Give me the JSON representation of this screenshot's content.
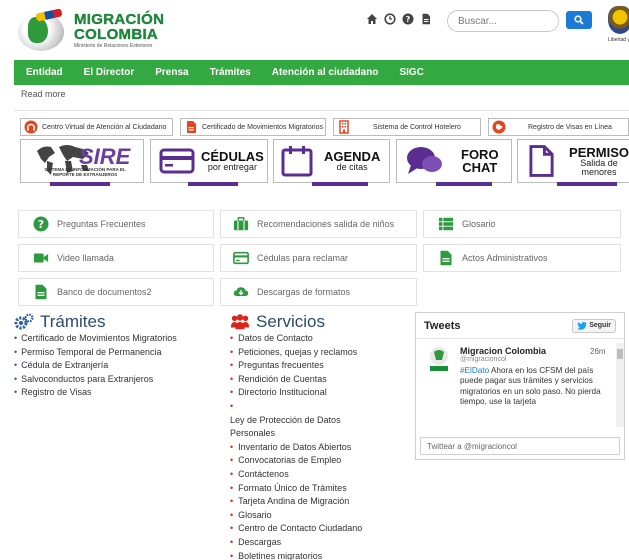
{
  "header": {
    "logo_line1": "MIGRACIÓN",
    "logo_line2": "COLOMBIA",
    "logo_subtitle": "Ministerio de Relaciones Exteriores",
    "search_placeholder": "Buscar...",
    "crest_text": "Libertad y Orden",
    "icons": [
      "home-icon",
      "clock-icon",
      "help-icon",
      "document-icon",
      "search-icon"
    ]
  },
  "nav": {
    "items": [
      "Entidad",
      "El Director",
      "Prensa",
      "Trámites",
      "Atención al ciudadano",
      "SIGC"
    ]
  },
  "read_more": "Read more",
  "quick_links": [
    {
      "label": "Centro Virtual de Atención al Ciudadano",
      "icon": "headset-icon",
      "color": "#e8431b"
    },
    {
      "label": "Certificado de Movimientos Migratorios",
      "icon": "pdf-icon",
      "color": "#e8431b"
    },
    {
      "label": "Sistema de Control Hotelero",
      "icon": "building-icon",
      "color": "#e8431b"
    },
    {
      "label": "Registro de Visas en Línea",
      "icon": "globe-icon",
      "color": "#e8431b"
    }
  ],
  "banners": {
    "sire": {
      "title": "SIRE",
      "subtitle_line1": "SISTEMA DE INFORMACIÓN PARA EL",
      "subtitle_line2": "REPORTE DE EXTRANJEROS"
    },
    "cedulas": {
      "title": "CÉDULAS",
      "subtitle": "por entregar"
    },
    "agenda": {
      "title": "AGENDA",
      "subtitle": "de citas"
    },
    "foro": {
      "line1": "FORO",
      "line2": "CHAT"
    },
    "permiso": {
      "title": "PERMISO",
      "subtitle_line1": "Salida de",
      "subtitle_line2": "menores"
    },
    "accent": "#5b2d91"
  },
  "tiles": [
    {
      "label": "Preguntas Frecuentes",
      "icon": "question-icon"
    },
    {
      "label": "Recomendaciones salida de niños",
      "icon": "briefcase-icon"
    },
    {
      "label": "Glosario",
      "icon": "list-icon"
    },
    {
      "label": "Video llamada",
      "icon": "video-camera-icon"
    },
    {
      "label": "Cédulas para reclamar",
      "icon": "card-icon"
    },
    {
      "label": "Actos Administrativos",
      "icon": "file-icon"
    },
    {
      "label": "Banco de documentos2",
      "icon": "file-icon"
    },
    {
      "label": "Descargas de formatos",
      "icon": "cloud-download-icon"
    }
  ],
  "tramites": {
    "title": "Trámites",
    "items": [
      "Certificado de Movimientos Migratorios",
      "Permiso Temporal de Permanencia",
      "Cédula de Extranjería",
      "Salvoconductos para Extranjeros",
      "Registro de Visas"
    ]
  },
  "servicios": {
    "title": "Servicios",
    "items": [
      "Datos de Contacto",
      "Peticiones, quejas y reclamos",
      "Preguntas frecuentes",
      "Rendición de Cuentas",
      "Directorio Institucional",
      "Ley de Protección de Datos Personales",
      "Inventario de Datos Abiertos",
      "Convocatorias de Empleo",
      "Contáctenos",
      "Formato Único de Trámites",
      "Tarjeta Andina de Migración",
      "Glosario",
      "Centro de Contacto Ciudadano",
      "Descargas",
      "Boletines migratorios"
    ]
  },
  "tweets": {
    "title": "Tweets",
    "follow_label": "Seguir",
    "tweet": {
      "name": "Migracion Colombia",
      "handle": "@migracioncol",
      "time": "26m",
      "hashtag": "#ElDato",
      "text": " Ahora en los CFSM del país puede pagar sus trámites y servicios migratorios en un solo paso. No pierda tiempo, use la tarjeta"
    },
    "compose_placeholder": "Twittear a @migracioncol"
  },
  "colors": {
    "nav_green": "#34a841",
    "title_blue": "#2a4a6e",
    "accent_purple": "#5b2d91",
    "tile_green": "#2e9a3e",
    "bullet_red": "#d9251c"
  }
}
